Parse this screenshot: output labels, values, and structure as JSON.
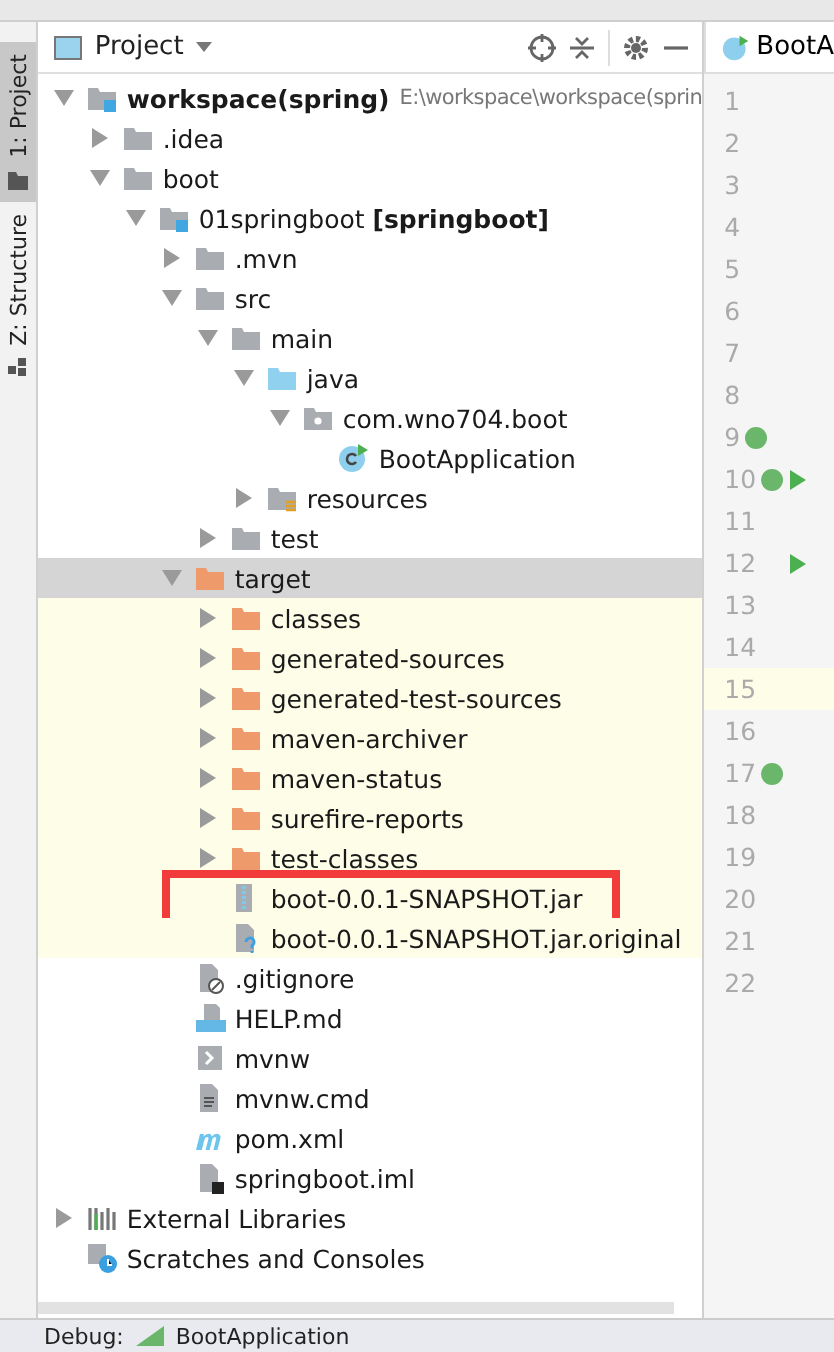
{
  "sidebar_tabs": [
    {
      "label": "1: Project",
      "selected": true
    },
    {
      "label": "Z: Structure",
      "selected": false
    }
  ],
  "panel": {
    "title": "Project"
  },
  "tree": [
    {
      "label": "**workspace(spring)**",
      "path": "E:\\workspace\\workspace(sprin",
      "kind": "module",
      "expanded": true,
      "children": [
        {
          "label": ".idea",
          "kind": "folder",
          "expanded": false
        },
        {
          "label": "boot",
          "kind": "folder",
          "expanded": true,
          "children": [
            {
              "label": "01springboot **[springboot]**",
              "kind": "module",
              "expanded": true,
              "children": [
                {
                  "label": ".mvn",
                  "kind": "folder",
                  "expanded": false
                },
                {
                  "label": "src",
                  "kind": "folder",
                  "expanded": true,
                  "children": [
                    {
                      "label": "main",
                      "kind": "folder",
                      "expanded": true,
                      "children": [
                        {
                          "label": "java",
                          "kind": "source",
                          "expanded": true,
                          "children": [
                            {
                              "label": "com.wno704.boot",
                              "kind": "package",
                              "expanded": true,
                              "children": [
                                {
                                  "label": "BootApplication",
                                  "kind": "class"
                                }
                              ]
                            }
                          ]
                        },
                        {
                          "label": "resources",
                          "kind": "resources",
                          "expanded": false
                        }
                      ]
                    },
                    {
                      "label": "test",
                      "kind": "folder",
                      "expanded": false
                    }
                  ]
                },
                {
                  "label": "target",
                  "kind": "excluded",
                  "expanded": true,
                  "selected": true,
                  "children": [
                    {
                      "label": "classes",
                      "kind": "excluded",
                      "expanded": false
                    },
                    {
                      "label": "generated-sources",
                      "kind": "excluded",
                      "expanded": false
                    },
                    {
                      "label": "generated-test-sources",
                      "kind": "excluded",
                      "expanded": false
                    },
                    {
                      "label": "maven-archiver",
                      "kind": "excluded",
                      "expanded": false
                    },
                    {
                      "label": "maven-status",
                      "kind": "excluded",
                      "expanded": false
                    },
                    {
                      "label": "surefire-reports",
                      "kind": "excluded",
                      "expanded": false
                    },
                    {
                      "label": "test-classes",
                      "kind": "excluded",
                      "expanded": false
                    },
                    {
                      "label": "boot-0.0.1-SNAPSHOT.jar",
                      "kind": "jar",
                      "highlighted": true
                    },
                    {
                      "label": "boot-0.0.1-SNAPSHOT.jar.original",
                      "kind": "unknown"
                    }
                  ]
                },
                {
                  "label": ".gitignore",
                  "kind": "ignore"
                },
                {
                  "label": "HELP.md",
                  "kind": "markdown"
                },
                {
                  "label": "mvnw",
                  "kind": "shell"
                },
                {
                  "label": "mvnw.cmd",
                  "kind": "text"
                },
                {
                  "label": "pom.xml",
                  "kind": "maven"
                },
                {
                  "label": "springboot.iml",
                  "kind": "iml"
                }
              ]
            }
          ]
        }
      ]
    },
    {
      "label": "External Libraries",
      "kind": "libraries",
      "expanded": false
    },
    {
      "label": "Scratches and Consoles",
      "kind": "scratches"
    }
  ],
  "editor": {
    "tab": "BootA",
    "lines": [
      {
        "number": "1",
        "current": false
      },
      {
        "number": "2",
        "current": false
      },
      {
        "number": "3",
        "current": false
      },
      {
        "number": "4",
        "current": false
      },
      {
        "number": "5",
        "current": false
      },
      {
        "number": "6",
        "current": false
      },
      {
        "number": "7",
        "current": false
      },
      {
        "number": "8",
        "current": false
      },
      {
        "number": "9",
        "current": false
      },
      {
        "number": "10",
        "current": false
      },
      {
        "number": "11",
        "current": false
      },
      {
        "number": "12",
        "current": false
      },
      {
        "number": "13",
        "current": false
      },
      {
        "number": "14",
        "current": false
      },
      {
        "number": "15",
        "current": true
      },
      {
        "number": "16",
        "current": false
      },
      {
        "number": "17",
        "current": false
      },
      {
        "number": "18",
        "current": false
      },
      {
        "number": "19",
        "current": false
      },
      {
        "number": "20",
        "current": false
      },
      {
        "number": "21",
        "current": false
      },
      {
        "number": "22",
        "current": false
      }
    ]
  },
  "bottom_bar": {
    "label": "Debug:",
    "config": "BootApplication"
  }
}
